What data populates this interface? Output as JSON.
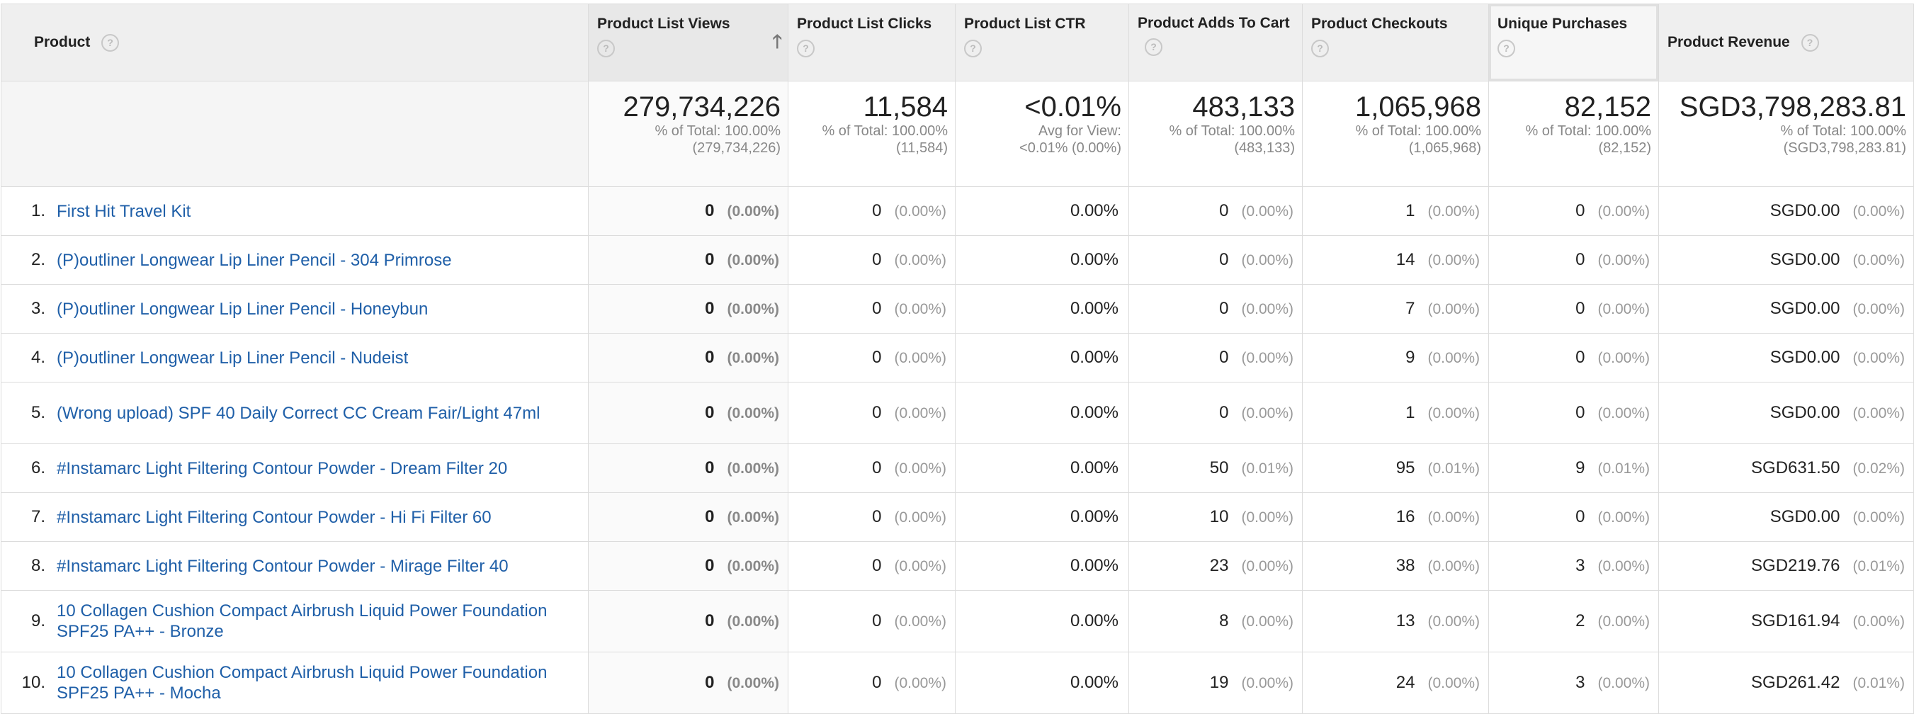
{
  "columns": {
    "product": "Product",
    "plv": "Product List Views",
    "plc": "Product List Clicks",
    "ctr": "Product List CTR",
    "atc": "Product Adds To Cart",
    "chk": "Product Checkouts",
    "up": "Unique Purchases",
    "rev": "Product Revenue"
  },
  "help_glyph": "?",
  "sort_glyph": "🡑",
  "totals": {
    "plv": {
      "value": "279,734,226",
      "l1": "% of Total: 100.00%",
      "l2": "(279,734,226)"
    },
    "plc": {
      "value": "11,584",
      "l1": "% of Total: 100.00%",
      "l2": "(11,584)"
    },
    "ctr": {
      "value": "<0.01%",
      "l1": "Avg for View:",
      "l2": "<0.01% (0.00%)"
    },
    "atc": {
      "value": "483,133",
      "l1": "% of Total: 100.00%",
      "l2": "(483,133)"
    },
    "chk": {
      "value": "1,065,968",
      "l1": "% of Total: 100.00%",
      "l2": "(1,065,968)"
    },
    "up": {
      "value": "82,152",
      "l1": "% of Total: 100.00%",
      "l2": "(82,152)"
    },
    "rev": {
      "value": "SGD3,798,283.81",
      "l1": "% of Total: 100.00%",
      "l2": "(SGD3,798,283.81)"
    }
  },
  "rows": [
    {
      "idx": "1.",
      "name": "First Hit Travel Kit",
      "plv": "0",
      "plv_p": "(0.00%)",
      "plc": "0",
      "plc_p": "(0.00%)",
      "ctr": "0.00%",
      "atc": "0",
      "atc_p": "(0.00%)",
      "chk": "1",
      "chk_p": "(0.00%)",
      "up": "0",
      "up_p": "(0.00%)",
      "rev": "SGD0.00",
      "rev_p": "(0.00%)"
    },
    {
      "idx": "2.",
      "name": "(P)outliner Longwear Lip Liner Pencil - 304 Primrose",
      "plv": "0",
      "plv_p": "(0.00%)",
      "plc": "0",
      "plc_p": "(0.00%)",
      "ctr": "0.00%",
      "atc": "0",
      "atc_p": "(0.00%)",
      "chk": "14",
      "chk_p": "(0.00%)",
      "up": "0",
      "up_p": "(0.00%)",
      "rev": "SGD0.00",
      "rev_p": "(0.00%)"
    },
    {
      "idx": "3.",
      "name": "(P)outliner Longwear Lip Liner Pencil - Honeybun",
      "plv": "0",
      "plv_p": "(0.00%)",
      "plc": "0",
      "plc_p": "(0.00%)",
      "ctr": "0.00%",
      "atc": "0",
      "atc_p": "(0.00%)",
      "chk": "7",
      "chk_p": "(0.00%)",
      "up": "0",
      "up_p": "(0.00%)",
      "rev": "SGD0.00",
      "rev_p": "(0.00%)"
    },
    {
      "idx": "4.",
      "name": "(P)outliner Longwear Lip Liner Pencil - Nudeist",
      "plv": "0",
      "plv_p": "(0.00%)",
      "plc": "0",
      "plc_p": "(0.00%)",
      "ctr": "0.00%",
      "atc": "0",
      "atc_p": "(0.00%)",
      "chk": "9",
      "chk_p": "(0.00%)",
      "up": "0",
      "up_p": "(0.00%)",
      "rev": "SGD0.00",
      "rev_p": "(0.00%)"
    },
    {
      "idx": "5.",
      "name": "(Wrong upload) SPF 40 Daily Correct CC Cream Fair/Light 47ml",
      "plv": "0",
      "plv_p": "(0.00%)",
      "plc": "0",
      "plc_p": "(0.00%)",
      "ctr": "0.00%",
      "atc": "0",
      "atc_p": "(0.00%)",
      "chk": "1",
      "chk_p": "(0.00%)",
      "up": "0",
      "up_p": "(0.00%)",
      "rev": "SGD0.00",
      "rev_p": "(0.00%)"
    },
    {
      "idx": "6.",
      "name": "#Instamarc Light Filtering Contour Powder - Dream Filter 20",
      "plv": "0",
      "plv_p": "(0.00%)",
      "plc": "0",
      "plc_p": "(0.00%)",
      "ctr": "0.00%",
      "atc": "50",
      "atc_p": "(0.01%)",
      "chk": "95",
      "chk_p": "(0.01%)",
      "up": "9",
      "up_p": "(0.01%)",
      "rev": "SGD631.50",
      "rev_p": "(0.02%)"
    },
    {
      "idx": "7.",
      "name": "#Instamarc Light Filtering Contour Powder - Hi Fi Filter 60",
      "plv": "0",
      "plv_p": "(0.00%)",
      "plc": "0",
      "plc_p": "(0.00%)",
      "ctr": "0.00%",
      "atc": "10",
      "atc_p": "(0.00%)",
      "chk": "16",
      "chk_p": "(0.00%)",
      "up": "0",
      "up_p": "(0.00%)",
      "rev": "SGD0.00",
      "rev_p": "(0.00%)"
    },
    {
      "idx": "8.",
      "name": "#Instamarc Light Filtering Contour Powder - Mirage Filter 40",
      "plv": "0",
      "plv_p": "(0.00%)",
      "plc": "0",
      "plc_p": "(0.00%)",
      "ctr": "0.00%",
      "atc": "23",
      "atc_p": "(0.00%)",
      "chk": "38",
      "chk_p": "(0.00%)",
      "up": "3",
      "up_p": "(0.00%)",
      "rev": "SGD219.76",
      "rev_p": "(0.01%)"
    },
    {
      "idx": "9.",
      "name": "10 Collagen Cushion Compact Airbrush Liquid Power Foundation SPF25 PA++ - Bronze",
      "plv": "0",
      "plv_p": "(0.00%)",
      "plc": "0",
      "plc_p": "(0.00%)",
      "ctr": "0.00%",
      "atc": "8",
      "atc_p": "(0.00%)",
      "chk": "13",
      "chk_p": "(0.00%)",
      "up": "2",
      "up_p": "(0.00%)",
      "rev": "SGD161.94",
      "rev_p": "(0.00%)"
    },
    {
      "idx": "10.",
      "name": "10 Collagen Cushion Compact Airbrush Liquid Power Foundation SPF25 PA++ - Mocha",
      "plv": "0",
      "plv_p": "(0.00%)",
      "plc": "0",
      "plc_p": "(0.00%)",
      "ctr": "0.00%",
      "atc": "19",
      "atc_p": "(0.00%)",
      "chk": "24",
      "chk_p": "(0.00%)",
      "up": "3",
      "up_p": "(0.00%)",
      "rev": "SGD261.42",
      "rev_p": "(0.01%)"
    }
  ]
}
